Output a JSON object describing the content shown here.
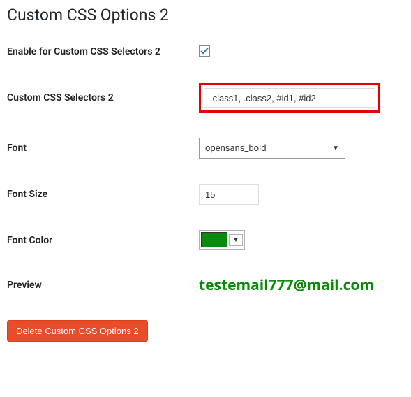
{
  "heading": "Custom CSS Options 2",
  "fields": {
    "enable": {
      "label": "Enable for Custom CSS Selectors 2",
      "checked": true
    },
    "selectors": {
      "label": "Custom CSS Selectors 2",
      "value": ".class1, .class2, #id1, #id2"
    },
    "font": {
      "label": "Font",
      "selected": "opensans_bold"
    },
    "font_size": {
      "label": "Font Size",
      "value": "15"
    },
    "font_color": {
      "label": "Font Color",
      "value": "#0a8a0a"
    },
    "preview": {
      "label": "Preview",
      "text": "testemail777@mail.com"
    }
  },
  "delete_button": "Delete Custom CSS Options 2"
}
